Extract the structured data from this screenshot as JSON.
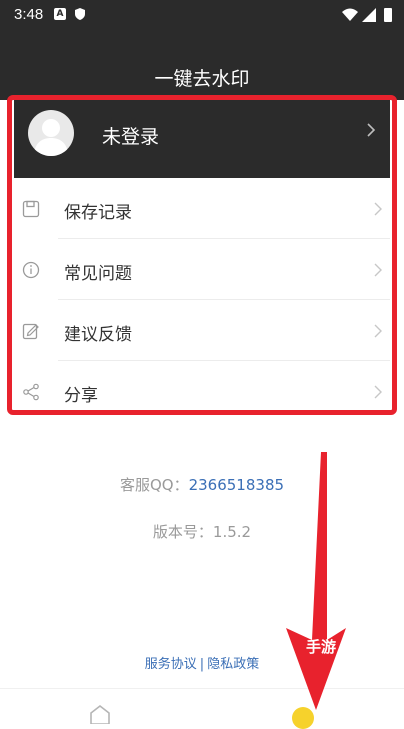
{
  "status_bar": {
    "time": "3:48",
    "notif_a": "A"
  },
  "header": {
    "title": "一键去水印"
  },
  "profile": {
    "name": "未登录"
  },
  "menu": [
    {
      "label": "保存记录",
      "icon": "save-icon"
    },
    {
      "label": "常见问题",
      "icon": "info-icon"
    },
    {
      "label": "建议反馈",
      "icon": "feedback-icon"
    },
    {
      "label": "分享",
      "icon": "share-icon"
    }
  ],
  "contact": {
    "label": "客服QQ：",
    "qq": "2366518385"
  },
  "version": {
    "text": "版本号：1.5.2"
  },
  "footer_links": {
    "service": "服务协议",
    "separator": "|",
    "privacy": "隐私政策"
  },
  "overlay_text": "手游",
  "colors": {
    "header_bg": "#2b2b2b",
    "highlight": "#e8222d",
    "link": "#3b6fb6",
    "accent": "#f6d22c"
  }
}
